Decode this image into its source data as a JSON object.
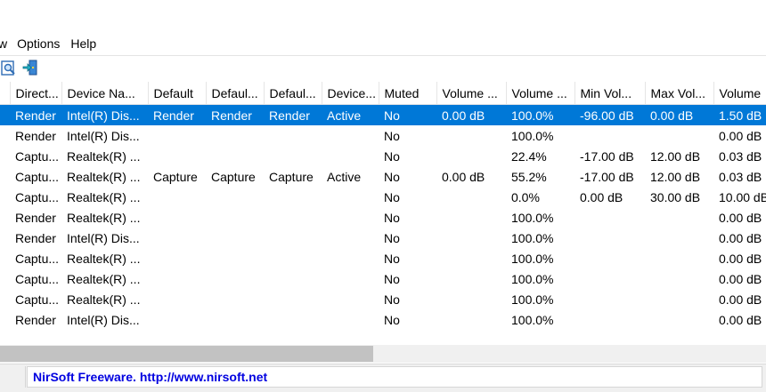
{
  "menu": {
    "items": [
      "w",
      "Options",
      "Help"
    ]
  },
  "toolbar": {
    "icons": [
      "properties-icon",
      "export-icon"
    ]
  },
  "table": {
    "columns": [
      "",
      "Direct...",
      "Device Na...",
      "Default",
      "Defaul...",
      "Defaul...",
      "Device...",
      "Muted",
      "Volume ...",
      "Volume ...",
      "Min Vol...",
      "Max Vol...",
      "Volume"
    ],
    "rows": [
      [
        "",
        "Render",
        "Intel(R) Dis...",
        "Render",
        "Render",
        "Render",
        "Active",
        "No",
        "0.00 dB",
        "100.0%",
        "-96.00 dB",
        "0.00 dB",
        "1.50 dB"
      ],
      [
        "",
        "Render",
        "Intel(R) Dis...",
        "",
        "",
        "",
        "",
        "No",
        "",
        "100.0%",
        "",
        "",
        "0.00 dB"
      ],
      [
        "",
        "Captu...",
        "Realtek(R) ...",
        "",
        "",
        "",
        "",
        "No",
        "",
        "22.4%",
        "-17.00 dB",
        "12.00 dB",
        "0.03 dB"
      ],
      [
        "",
        "Captu...",
        "Realtek(R) ...",
        "Capture",
        "Capture",
        "Capture",
        "Active",
        "No",
        "0.00 dB",
        "55.2%",
        "-17.00 dB",
        "12.00 dB",
        "0.03 dB"
      ],
      [
        "",
        "Captu...",
        "Realtek(R) ...",
        "",
        "",
        "",
        "",
        "No",
        "",
        "0.0%",
        "0.00 dB",
        "30.00 dB",
        "10.00 dB"
      ],
      [
        "",
        "Render",
        "Realtek(R) ...",
        "",
        "",
        "",
        "",
        "No",
        "",
        "100.0%",
        "",
        "",
        "0.00 dB"
      ],
      [
        "",
        "Render",
        "Intel(R) Dis...",
        "",
        "",
        "",
        "",
        "No",
        "",
        "100.0%",
        "",
        "",
        "0.00 dB"
      ],
      [
        "",
        "Captu...",
        "Realtek(R) ...",
        "",
        "",
        "",
        "",
        "No",
        "",
        "100.0%",
        "",
        "",
        "0.00 dB"
      ],
      [
        "",
        "Captu...",
        "Realtek(R) ...",
        "",
        "",
        "",
        "",
        "No",
        "",
        "100.0%",
        "",
        "",
        "0.00 dB"
      ],
      [
        "",
        "Captu...",
        "Realtek(R) ...",
        "",
        "",
        "",
        "",
        "No",
        "",
        "100.0%",
        "",
        "",
        "0.00 dB"
      ],
      [
        "",
        "Render",
        "Intel(R) Dis...",
        "",
        "",
        "",
        "",
        "No",
        "",
        "100.0%",
        "",
        "",
        "0.00 dB"
      ]
    ],
    "selected_row": 0
  },
  "status": {
    "text": "NirSoft Freeware.  http://www.nirsoft.net"
  },
  "colors": {
    "selection": "#0078d7",
    "link": "#0000e0"
  }
}
